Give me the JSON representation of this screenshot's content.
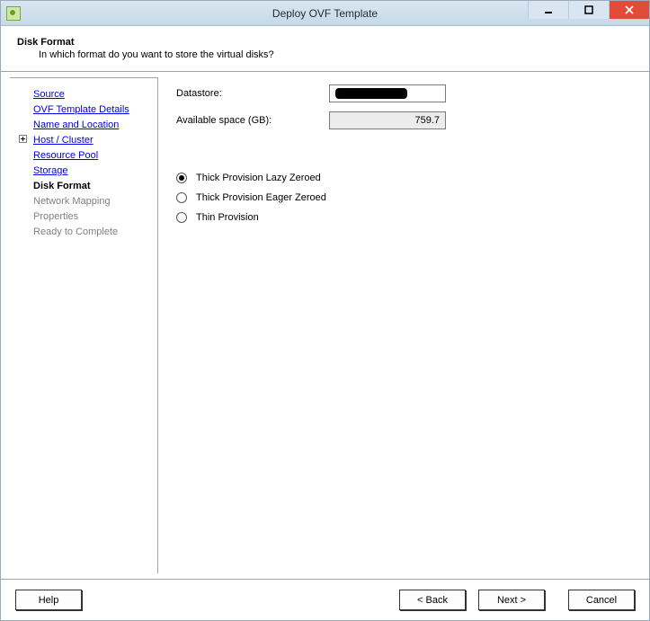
{
  "window": {
    "title": "Deploy OVF Template"
  },
  "header": {
    "title": "Disk Format",
    "description": "In which format do you want to store the virtual disks?"
  },
  "sidebar": {
    "steps": [
      {
        "label": "Source",
        "state": "done"
      },
      {
        "label": "OVF Template Details",
        "state": "done"
      },
      {
        "label": "Name and Location",
        "state": "done"
      },
      {
        "label": "Host / Cluster",
        "state": "done-expand"
      },
      {
        "label": "Resource Pool",
        "state": "done"
      },
      {
        "label": "Storage",
        "state": "done"
      },
      {
        "label": "Disk Format",
        "state": "current"
      },
      {
        "label": "Network Mapping",
        "state": "future"
      },
      {
        "label": "Properties",
        "state": "future"
      },
      {
        "label": "Ready to Complete",
        "state": "future"
      }
    ]
  },
  "content": {
    "datastore_label": "Datastore:",
    "datastore_value": "",
    "avail_label": "Available space (GB):",
    "avail_value": "759.7",
    "radios": [
      {
        "label": "Thick Provision Lazy Zeroed",
        "checked": true
      },
      {
        "label": "Thick Provision Eager Zeroed",
        "checked": false
      },
      {
        "label": "Thin Provision",
        "checked": false
      }
    ]
  },
  "footer": {
    "help": "Help",
    "back": "< Back",
    "next": "Next >",
    "cancel": "Cancel"
  }
}
